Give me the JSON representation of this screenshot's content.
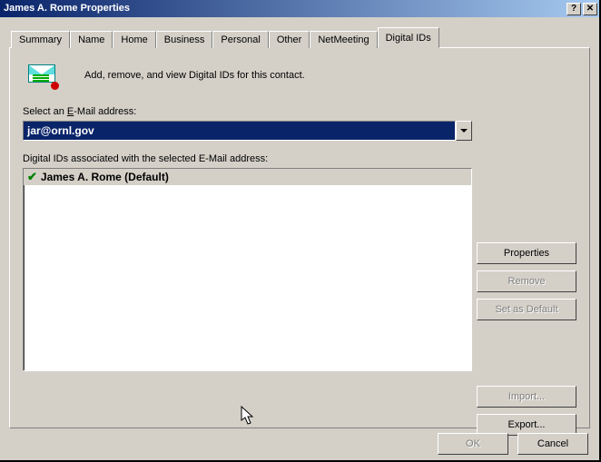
{
  "window": {
    "title": "James A. Rome Properties"
  },
  "tabs": {
    "items": [
      {
        "label": "Summary"
      },
      {
        "label": "Name"
      },
      {
        "label": "Home"
      },
      {
        "label": "Business"
      },
      {
        "label": "Personal"
      },
      {
        "label": "Other"
      },
      {
        "label": "NetMeeting"
      },
      {
        "label": "Digital IDs"
      }
    ],
    "active_index": 7
  },
  "panel": {
    "description": "Add, remove, and view Digital IDs for this contact.",
    "email_label_prefix": "Select an ",
    "email_label_underlined": "E",
    "email_label_suffix": "-Mail address:",
    "email_value": "jar@ornl.gov",
    "list_label": "Digital IDs associated with the selected E-Mail address:",
    "list_items": [
      {
        "checked": true,
        "text": "James A. Rome  (Default)"
      }
    ]
  },
  "buttons": {
    "properties": "Properties",
    "remove": "Remove",
    "set_default": "Set as Default",
    "import": "Import...",
    "export": "Export...",
    "ok": "OK",
    "cancel": "Cancel"
  }
}
